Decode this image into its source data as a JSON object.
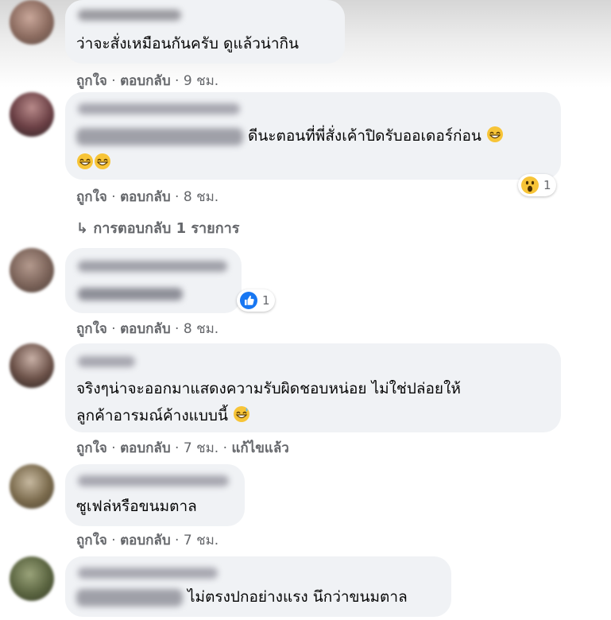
{
  "actions": {
    "like": "ถูกใจ",
    "reply": "ตอบกลับ",
    "dot": "·"
  },
  "comments": [
    {
      "text": "ว่าจะสั่งเหมือนกันครับ ดูแล้วน่ากิน",
      "time": "9 ชม."
    },
    {
      "text": "ดีนะตอนที่พี่สั่งเค้าปิดรับออเดอร์ก่อน",
      "time": "8 ชม.",
      "reaction": {
        "icon": "wow-icon",
        "count": "1"
      },
      "replies_label": "การตอบกลับ 1 รายการ"
    },
    {
      "time": "8 ชม.",
      "reaction": {
        "icon": "like-icon",
        "count": "1"
      }
    },
    {
      "line1": "จริงๆน่าจะออกมาแสดงความรับผิดชอบหน่อย ไม่ใช่ปล่อยให้",
      "line2": "ลูกค้าอารมณ์ค้างแบบนี้",
      "time": "7 ชม.",
      "edited": "แก้ไขแล้ว"
    },
    {
      "text": "ซูเฟล่หรือขนมตาล",
      "time": "7 ชม."
    },
    {
      "text": "ไม่ตรงปกอย่างแรง นึกว่าขนมตาล"
    }
  ],
  "colors": {
    "bubble": "#f0f2f5",
    "meta": "#65676b",
    "like_blue": "#1877f2",
    "emoji_yellow": "#f7c437"
  }
}
